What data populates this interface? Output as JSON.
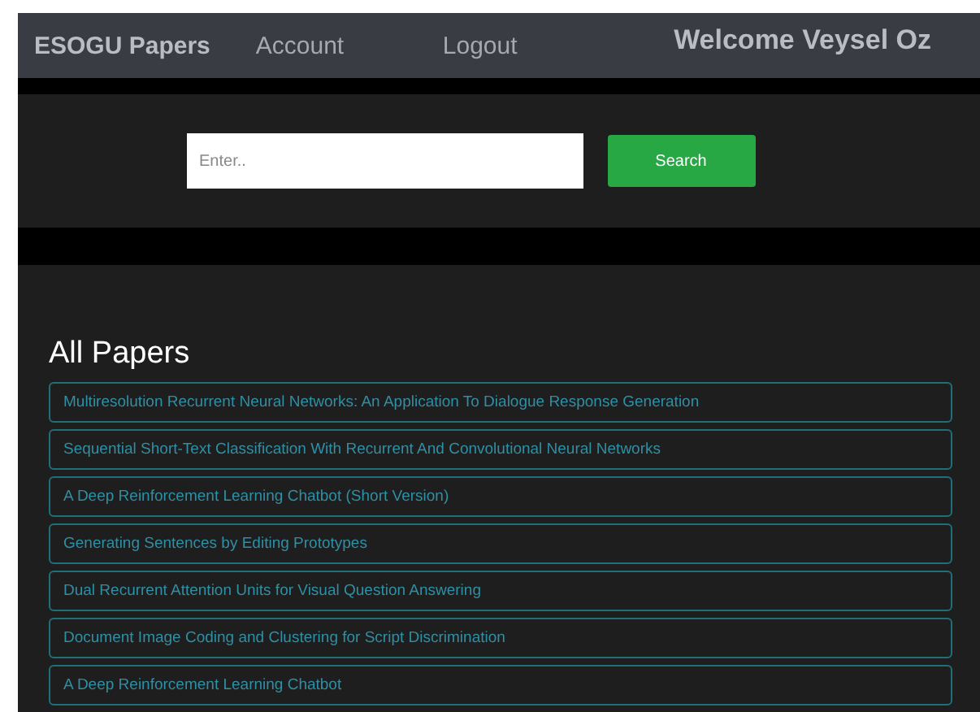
{
  "navbar": {
    "brand": "ESOGU Papers",
    "links": [
      "Account",
      "Logout"
    ],
    "welcome": "Welcome Veysel Oz"
  },
  "search": {
    "placeholder": "Enter..",
    "button": "Search"
  },
  "papers": {
    "title": "All Papers",
    "items": [
      "Multiresolution Recurrent Neural Networks: An Application To Dialogue Response Generation",
      "Sequential Short-Text Classification With Recurrent And Convolutional Neural Networks",
      "A Deep Reinforcement Learning Chatbot (Short Version)",
      "Generating Sentences by Editing Prototypes",
      "Dual Recurrent Attention Units for Visual Question Answering",
      "Document Image Coding and Clustering for Script Discrimination",
      "A Deep Reinforcement Learning Chatbot"
    ]
  }
}
